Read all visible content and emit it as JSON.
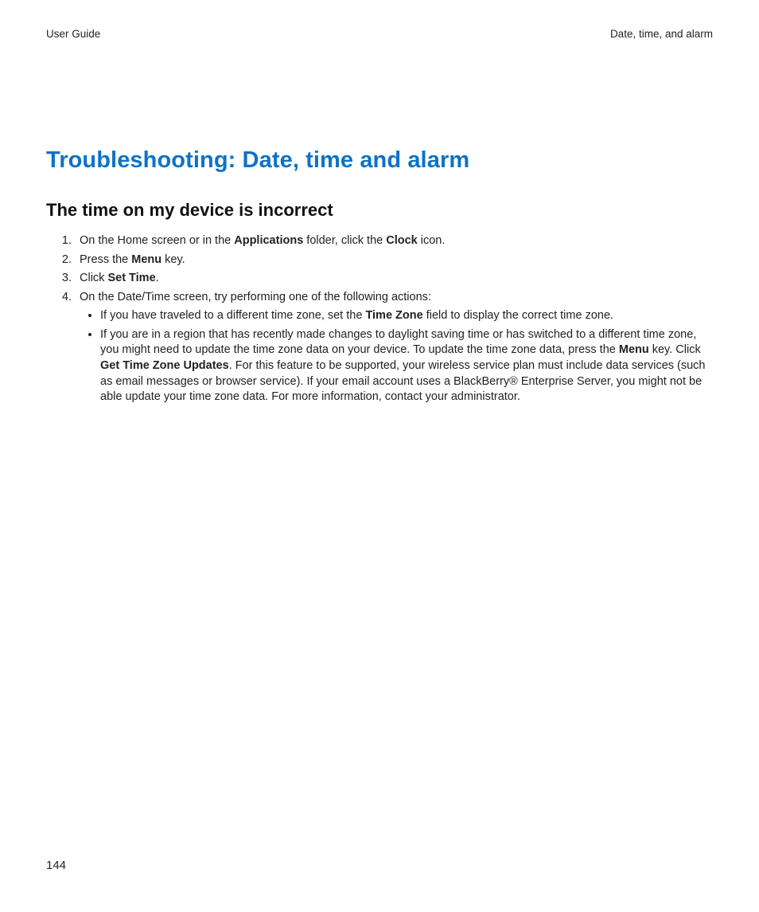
{
  "header": {
    "left": "User Guide",
    "right": "Date, time, and alarm"
  },
  "title": "Troubleshooting: Date, time and alarm",
  "subtitle": "The time on my device is incorrect",
  "steps": {
    "s1": {
      "t1": "On the Home screen or in the ",
      "b1": "Applications",
      "t2": " folder, click the ",
      "b2": "Clock",
      "t3": " icon."
    },
    "s2": {
      "t1": "Press the ",
      "b1": "Menu",
      "t2": " key."
    },
    "s3": {
      "t1": "Click ",
      "b1": "Set Time",
      "t2": "."
    },
    "s4": {
      "t1": "On the Date/Time screen, try performing one of the following actions:",
      "sub1": {
        "t1": "If you have traveled to a different time zone, set the ",
        "b1": "Time Zone",
        "t2": " field to display the correct time zone."
      },
      "sub2": {
        "t1": "If you are in a region that has recently made changes to daylight saving time or has switched to a different time zone, you might need to update the time zone data on your device. To update the time zone data, press the ",
        "b1": "Menu",
        "t2": " key. Click ",
        "b2": "Get Time Zone Updates",
        "t3": ". For this feature to be supported, your wireless service plan must include data services (such as email messages or browser service). If your email account uses a BlackBerry® Enterprise Server, you might not be able update your time zone data. For more information, contact your administrator."
      }
    }
  },
  "pageNumber": "144"
}
